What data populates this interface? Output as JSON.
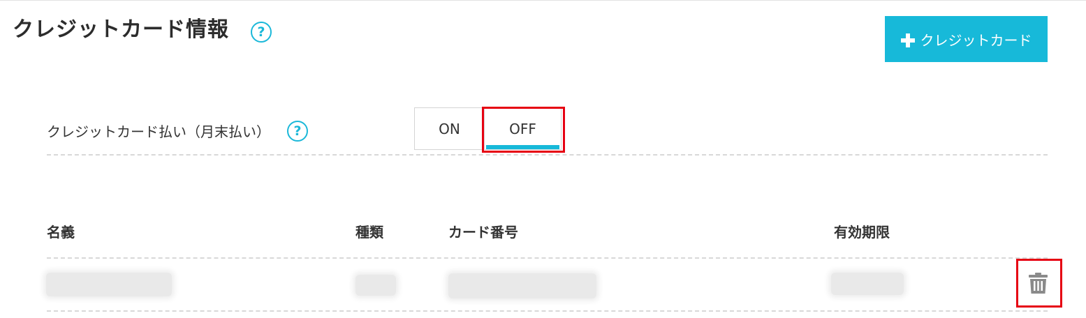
{
  "header": {
    "title": "クレジットカード情報",
    "help_icon": "question-circle-icon",
    "add_button_label": "クレジットカード",
    "add_button_icon": "plus-icon"
  },
  "payment_toggle": {
    "label": "クレジットカード払い（月末払い）",
    "help_icon": "question-circle-icon",
    "options": [
      "ON",
      "OFF"
    ],
    "selected": "OFF"
  },
  "table": {
    "columns": [
      "名義",
      "種類",
      "カード番号",
      "有効期限"
    ],
    "rows": [
      {
        "name": "",
        "type": "",
        "number": "",
        "expiry": "",
        "delete_icon": "trash-icon"
      }
    ]
  },
  "colors": {
    "accent": "#17b9d9",
    "highlight": "#e60012",
    "text": "#333333"
  }
}
